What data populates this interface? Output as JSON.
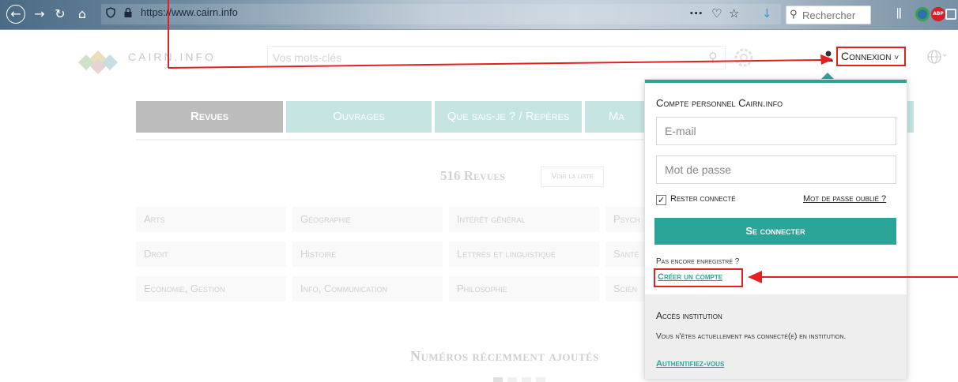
{
  "browser": {
    "url": "https://www.cairn.info",
    "search_placeholder": "Rechercher",
    "menu_dots": "···"
  },
  "header": {
    "logo_text": "CAIRN.INFO",
    "search_placeholder": "Vos mots-clés",
    "connexion_label": "Connexion"
  },
  "tabs": [
    {
      "label": "Revues"
    },
    {
      "label": "Ouvrages"
    },
    {
      "label": "Que sais-je ? / Repères"
    },
    {
      "label": "Ma"
    }
  ],
  "main": {
    "count_title": "516 Revues",
    "voir_label": "Voir la liste",
    "categories": [
      {
        "label": "Arts"
      },
      {
        "label": "Géographie"
      },
      {
        "label": "Intérêt général"
      },
      {
        "label": "Psych"
      },
      {
        "label": "Droit"
      },
      {
        "label": "Histoire"
      },
      {
        "label": "Lettres et linguistique"
      },
      {
        "label": "Santé"
      },
      {
        "label": "Economie, Gestion"
      },
      {
        "label": "Info, Communication"
      },
      {
        "label": "Philosophie"
      },
      {
        "label": "Scien"
      }
    ],
    "recent_title": "Numéros récemment ajoutés"
  },
  "login": {
    "title": "Compte personnel Cairn.info",
    "email_placeholder": "E-mail",
    "password_placeholder": "Mot de passe",
    "remember_label": "Rester connecté",
    "forgot_label": "Mot de passe oublié ?",
    "connect_label": "Se connecter",
    "not_registered": "Pas encore enregistré ?",
    "create_account": "Créer un compte",
    "institution_title": "Accès institution",
    "institution_text": "Vous n'êtes actuellement pas connecté(e) en institution.",
    "authenticate": "Authentifiez-vous"
  },
  "colors": {
    "teal": "#2aa598",
    "light_teal": "#c6e4e2",
    "annotation_red": "#e2201e",
    "active_tab": "#bcbcbc"
  }
}
